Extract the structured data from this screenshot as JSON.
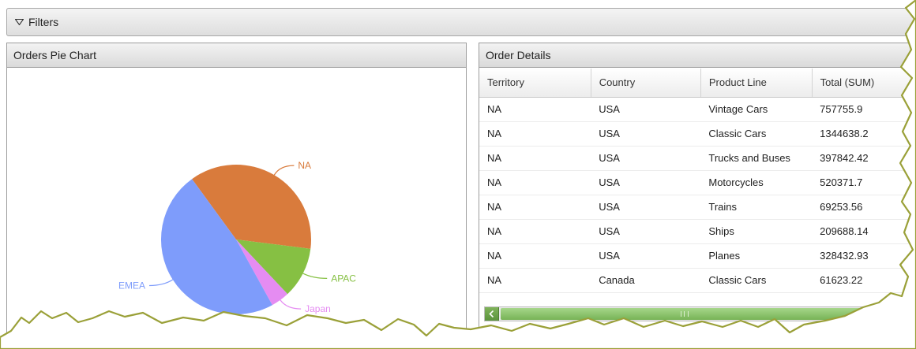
{
  "filters": {
    "label": "Filters"
  },
  "pie_panel": {
    "title": "Orders Pie Chart"
  },
  "details_panel": {
    "title": "Order Details",
    "columns": [
      "Territory",
      "Country",
      "Product Line",
      "Total (SUM)"
    ],
    "rows": [
      [
        "NA",
        "USA",
        "Vintage Cars",
        "757755.9"
      ],
      [
        "NA",
        "USA",
        "Classic Cars",
        "1344638.2"
      ],
      [
        "NA",
        "USA",
        "Trucks and Buses",
        "397842.42"
      ],
      [
        "NA",
        "USA",
        "Motorcycles",
        "520371.7"
      ],
      [
        "NA",
        "USA",
        "Trains",
        "69253.56"
      ],
      [
        "NA",
        "USA",
        "Ships",
        "209688.14"
      ],
      [
        "NA",
        "USA",
        "Planes",
        "328432.93"
      ],
      [
        "NA",
        "Canada",
        "Classic Cars",
        "61623.22"
      ]
    ]
  },
  "chart_data": {
    "type": "pie",
    "categories": [
      "NA",
      "APAC",
      "Japan",
      "EMEA"
    ],
    "values": [
      37,
      11,
      4,
      48
    ],
    "colors": [
      "#d97b3c",
      "#86c043",
      "#e58cf2",
      "#7e9cfb"
    ],
    "title": "",
    "legend": "none"
  }
}
